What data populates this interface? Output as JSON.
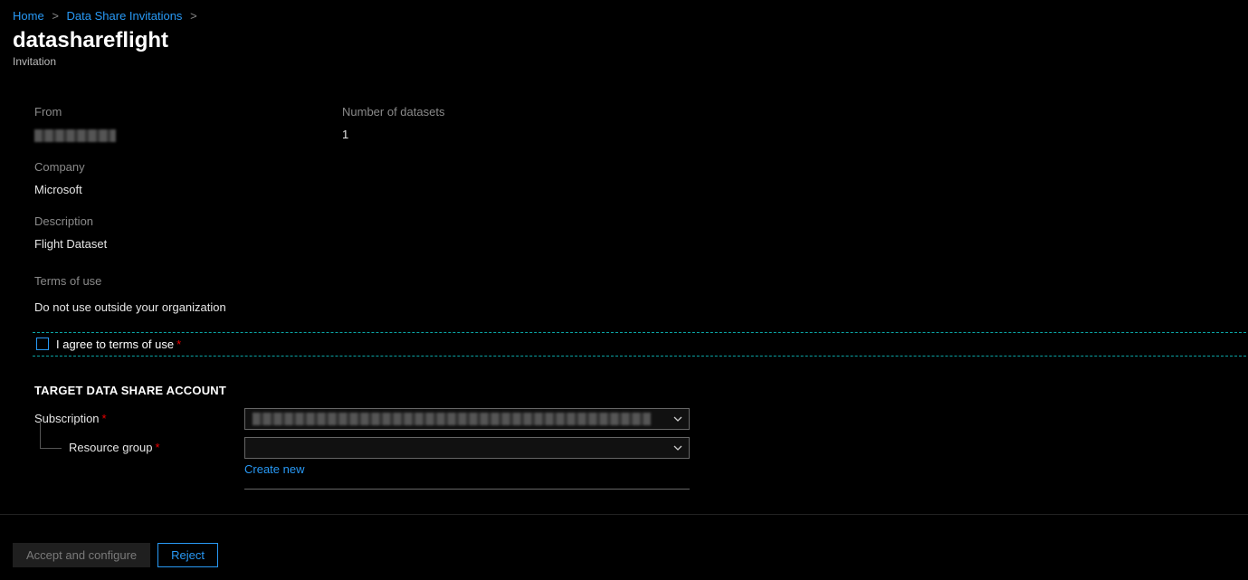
{
  "breadcrumb": {
    "home": "Home",
    "invitations": "Data Share Invitations"
  },
  "header": {
    "title": "datashareflight",
    "subtitle": "Invitation"
  },
  "details": {
    "from_label": "From",
    "from_value": "",
    "company_label": "Company",
    "company_value": "Microsoft",
    "description_label": "Description",
    "description_value": "Flight Dataset",
    "datasets_label": "Number of datasets",
    "datasets_value": "1",
    "terms_label": "Terms of use",
    "terms_value": "Do not use outside your organization",
    "agree_label": "I agree to terms of use"
  },
  "section": {
    "target_header": "TARGET DATA SHARE ACCOUNT",
    "subscription_label": "Subscription",
    "subscription_value": "",
    "resource_group_label": "Resource group",
    "resource_group_value": "",
    "create_new": "Create new"
  },
  "footer": {
    "accept": "Accept and configure",
    "reject": "Reject"
  }
}
